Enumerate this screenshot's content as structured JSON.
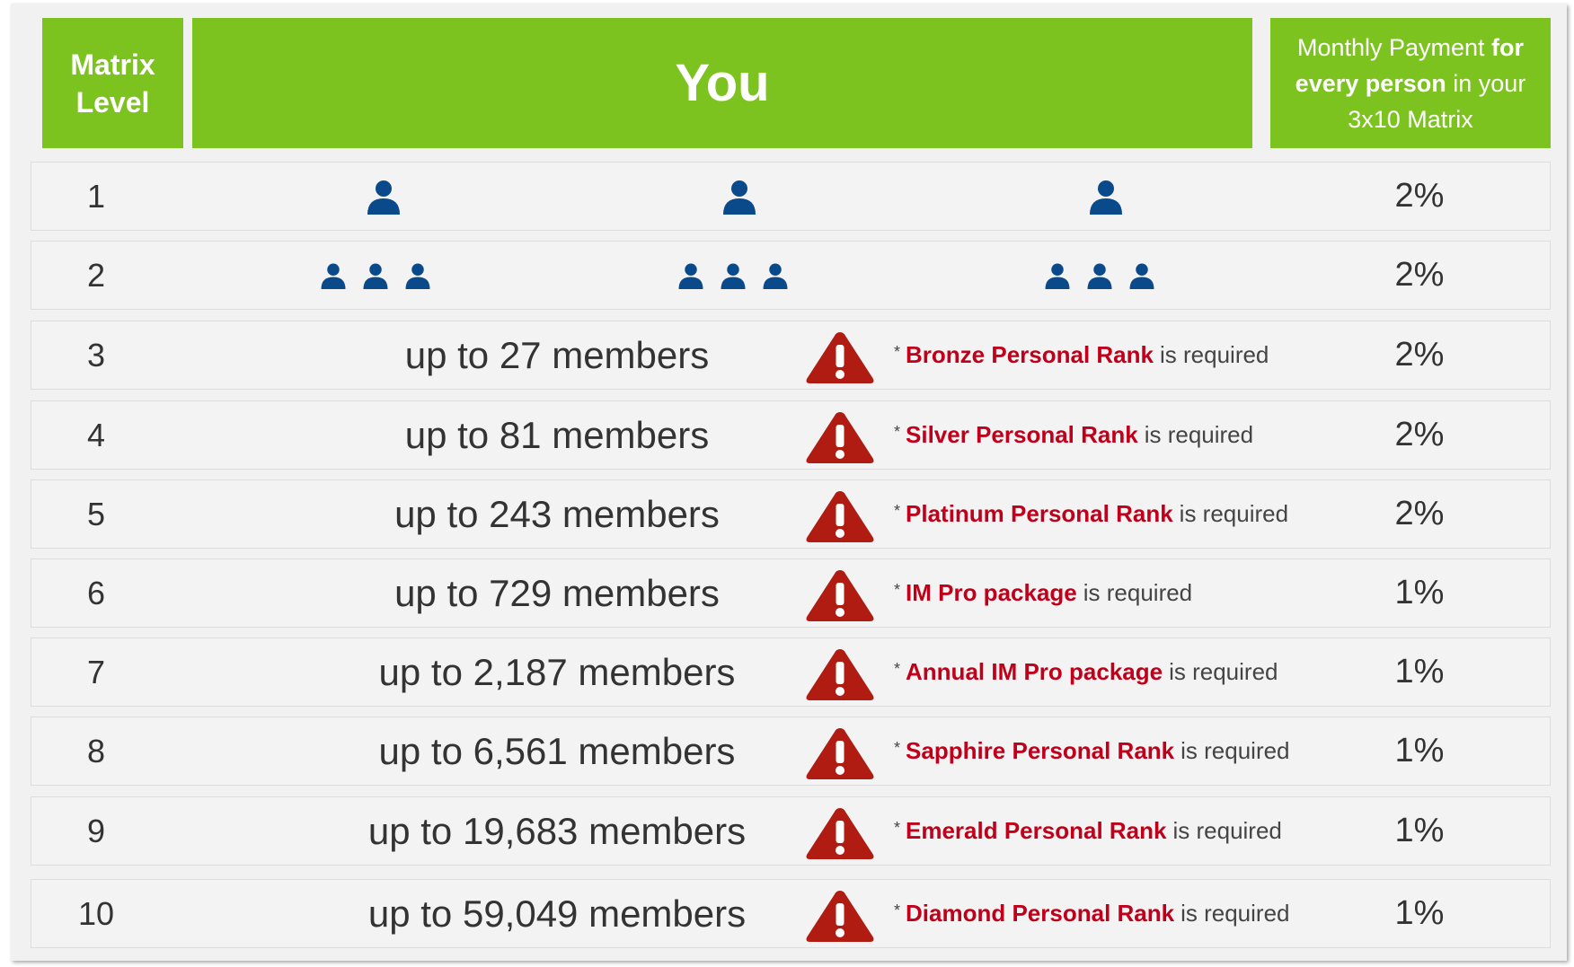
{
  "header": {
    "matrix_level": "Matrix Level",
    "you": "You",
    "payment_part1": "Monthly Payment ",
    "payment_bold1": "for every person",
    "payment_part2": " in your 3x10 Matrix"
  },
  "colors": {
    "header_green": "#7dc31f",
    "person_blue": "#0a4a8a",
    "warning_red": "#b01c12",
    "rank_red": "#c0001a"
  },
  "rows": [
    {
      "level": "1",
      "percent": "2%",
      "icon": "person-icon",
      "persons_per_group": 1
    },
    {
      "level": "2",
      "percent": "2%",
      "icon": "person-icon",
      "persons_per_group": 3
    },
    {
      "level": "3",
      "members": "up to 27 members",
      "requirement": "Bronze Personal Rank",
      "suffix": "is required",
      "percent": "2%"
    },
    {
      "level": "4",
      "members": "up to 81 members",
      "requirement": "Silver Personal Rank",
      "suffix": "is required",
      "percent": "2%"
    },
    {
      "level": "5",
      "members": "up to 243 members",
      "requirement": "Platinum Personal Rank",
      "suffix": "is required",
      "percent": "2%"
    },
    {
      "level": "6",
      "members": "up to 729 members",
      "requirement": "IM Pro package",
      "suffix": "is required",
      "percent": "1%"
    },
    {
      "level": "7",
      "members": "up to 2,187 members",
      "requirement": "Annual IM Pro package",
      "suffix": "is required",
      "percent": "1%"
    },
    {
      "level": "8",
      "members": "up to 6,561 members",
      "requirement": "Sapphire Personal Rank",
      "suffix": "is required",
      "percent": "1%"
    },
    {
      "level": "9",
      "members": "up to 19,683 members",
      "requirement": "Emerald Personal Rank",
      "suffix": "is required",
      "percent": "1%"
    },
    {
      "level": "10",
      "members": "up to 59,049 members",
      "requirement": "Diamond Personal Rank",
      "suffix": "is required",
      "percent": "1%"
    }
  ],
  "star": "*",
  "warning_icon": "warning-triangle-icon"
}
